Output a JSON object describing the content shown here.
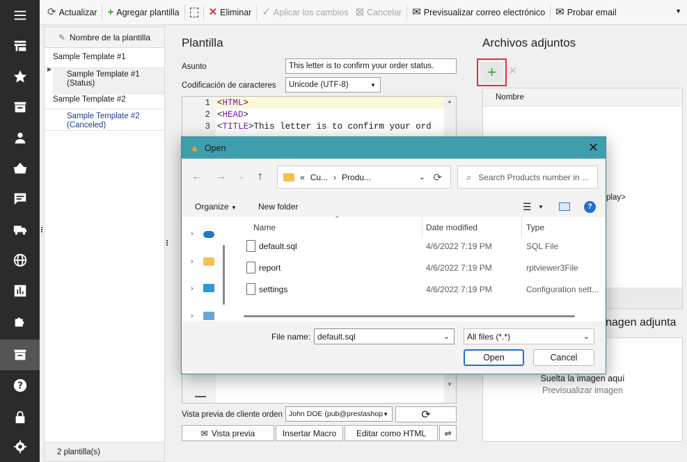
{
  "sidebar": {
    "icons": [
      "menu-icon",
      "store-icon",
      "star-icon",
      "inbox-icon",
      "person-icon",
      "basket-icon",
      "chat-icon",
      "truck-icon",
      "globe-icon",
      "chart-icon",
      "puzzle-icon",
      "mail-template-icon",
      "help-icon",
      "lock-icon",
      "settings-icon"
    ]
  },
  "toolbar": {
    "refresh": "Actualizar",
    "add_template": "Agregar plantilla",
    "delete": "Eliminar",
    "apply_changes": "Aplicar los cambios",
    "cancel": "Cancelar",
    "preview_email": "Previsualizar correo electrónico",
    "test_email": "Probar email"
  },
  "template_list": {
    "header": "Nombre de la plantilla",
    "items": [
      {
        "name": "Sample Template #1",
        "children": [
          "Sample Template #1 (Status)"
        ]
      },
      {
        "name": "Sample Template #2",
        "children": [
          "Sample Template #2 (Canceled)"
        ]
      }
    ],
    "footer": "2 plantilla(s)"
  },
  "template": {
    "title": "Plantilla",
    "subject_label": "Asunto",
    "subject_value": "This letter is to confirm your order status.",
    "encoding_label": "Codificación de caracteres",
    "encoding_value": "Unicode (UTF-8)",
    "code_lines": [
      {
        "n": "1",
        "parts": [
          {
            "t": "<",
            "k": false
          },
          {
            "t": "HTML",
            "k": true
          },
          {
            "t": ">",
            "k": false
          }
        ]
      },
      {
        "n": "2",
        "parts": [
          {
            "t": "<",
            "k": false
          },
          {
            "t": "HEAD",
            "k": true
          },
          {
            "t": ">",
            "k": false
          }
        ]
      },
      {
        "n": "3",
        "parts": [
          {
            "t": "<",
            "k": false
          },
          {
            "t": "TITLE",
            "k": true
          },
          {
            "t": ">This letter is to confirm your ord",
            "k": false
          }
        ]
      }
    ],
    "preview_customer_label": "Vista previa de cliente orden",
    "preview_customer_value": "John DOE (pub@prestashop",
    "preview_btn": "Vista previa",
    "macro_btn": "Insertar Macro",
    "edit_html_btn": "Editar como HTML"
  },
  "attachments": {
    "title": "Archivos adjuntos",
    "column_name": "Nombre",
    "partial_text": "play>",
    "image_title_partial": "nagen adjunta",
    "drop_text": "Suelta la imagen aquí",
    "preview_image": "Previsualizar imagen"
  },
  "dialog": {
    "title": "Open",
    "breadcrumb": [
      "Cu...",
      "Produ..."
    ],
    "search_placeholder": "Search Products number in ...",
    "organize": "Organize",
    "new_folder": "New folder",
    "columns": {
      "name": "Name",
      "date": "Date modified",
      "type": "Type"
    },
    "files": [
      {
        "name": "default.sql",
        "date": "4/6/2022 7:19 PM",
        "type": "SQL File"
      },
      {
        "name": "report",
        "date": "4/6/2022 7:19 PM",
        "type": "rptviewer3File"
      },
      {
        "name": "settings",
        "date": "4/6/2022 7:19 PM",
        "type": "Configuration sett..."
      }
    ],
    "file_name_label": "File name:",
    "file_name_value": "default.sql",
    "filter_value": "All files (*.*)",
    "open_btn": "Open",
    "cancel_btn": "Cancel"
  },
  "colors": {
    "accent": "#3d9fad",
    "highlight": "#e0313a",
    "add_green": "#2aa52a"
  }
}
